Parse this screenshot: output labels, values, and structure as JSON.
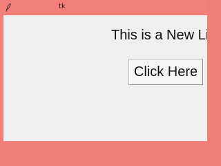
{
  "window": {
    "title": "tk",
    "icon": "feather-icon",
    "frame_color": "#f27f78",
    "background_color": "#efefef"
  },
  "main": {
    "label_text": "This is a New Li",
    "button_label": "Click Here"
  }
}
